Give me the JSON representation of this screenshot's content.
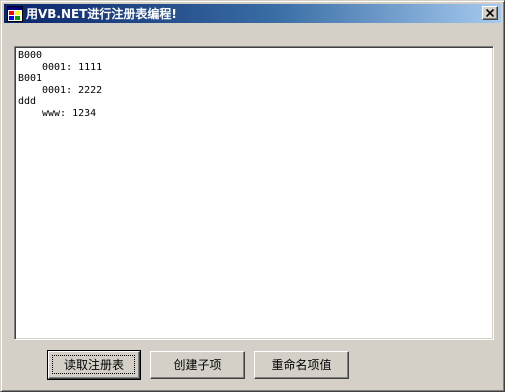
{
  "window": {
    "title": "用VB.NET进行注册表编程!",
    "icon": "app-window-icon",
    "close_icon": "close-icon"
  },
  "output": {
    "lines": [
      {
        "text": "B000",
        "indent": false
      },
      {
        "text": "0001: 1111",
        "indent": true
      },
      {
        "text": "B001",
        "indent": false
      },
      {
        "text": "0001: 2222",
        "indent": true
      },
      {
        "text": "ddd",
        "indent": false
      },
      {
        "text": "www: 1234",
        "indent": true
      }
    ]
  },
  "buttons": {
    "read_registry": "读取注册表",
    "create_subkey": "创建子项",
    "rename_value": "重命名项值"
  }
}
